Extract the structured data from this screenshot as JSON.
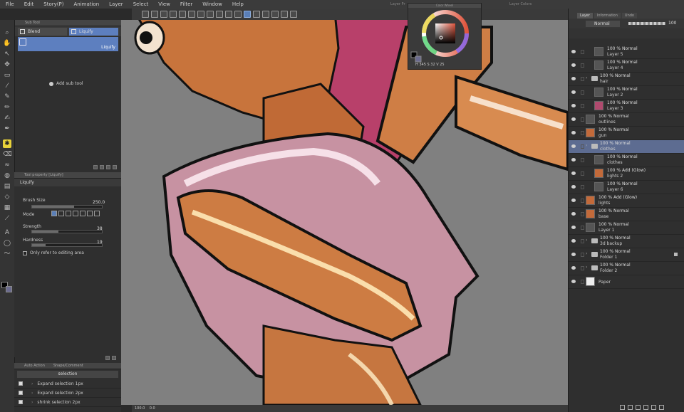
{
  "menu": {
    "items": [
      "File",
      "Edit",
      "Story(P)",
      "Animation",
      "Layer",
      "Select",
      "View",
      "Filter",
      "Window",
      "Help"
    ],
    "panel_titles": [
      "Layer Pr",
      "Color Wheel",
      "Layer Colors"
    ]
  },
  "sub_tool": {
    "header": "Sub Tool",
    "tabs": [
      "Blend",
      "Liquify"
    ],
    "selected_tool": "Liquify",
    "add_label": "Add sub tool"
  },
  "tool_property": {
    "header": "Tool property [Liquify]",
    "tool_name": "Liquify",
    "brush_size_label": "Brush Size",
    "brush_size_value": "250.0",
    "mode_label": "Mode",
    "strength_label": "Strength",
    "strength_value": "38",
    "hardness_label": "Hardness",
    "hardness_value": "19",
    "only_editing_label": "Only refer to editing area"
  },
  "auto_action": {
    "header": "Auto Action",
    "tab2": "Shape/Comment",
    "set_name": "selection",
    "items": [
      "Expand selection 1px",
      "Expand selection 2px",
      "shrink selection 2px"
    ]
  },
  "color_wheel": {
    "h": "345",
    "s": "32",
    "v": "25",
    "main_color": "#8b4f5b"
  },
  "layer_panel": {
    "tabs": [
      "Layer",
      "Information",
      "Undo"
    ],
    "blend_mode": "Normal",
    "opacity": "100",
    "layers": [
      {
        "l1": "100 % Normal",
        "l2": "Layer 5",
        "indent": 2,
        "thumb": "grey",
        "type": "layer"
      },
      {
        "l1": "100 % Normal",
        "l2": "Layer 4",
        "indent": 2,
        "thumb": "grey",
        "type": "layer"
      },
      {
        "l1": "100 % Normal",
        "l2": "hair",
        "indent": 1,
        "thumb": "white",
        "type": "folder"
      },
      {
        "l1": "100 % Normal",
        "l2": "Layer 2",
        "indent": 2,
        "thumb": "grey",
        "type": "layer"
      },
      {
        "l1": "100 % Normal",
        "l2": "Layer 3",
        "indent": 2,
        "thumb": "pink",
        "type": "layer"
      },
      {
        "l1": "100 % Normal",
        "l2": "outlines",
        "indent": 1,
        "thumb": "grey",
        "type": "layer"
      },
      {
        "l1": "100 % Normal",
        "l2": "gun",
        "indent": 1,
        "thumb": "orange",
        "type": "layer"
      },
      {
        "l1": "100 % Normal",
        "l2": "clothes",
        "indent": 1,
        "thumb": "white",
        "type": "folder",
        "selected": true
      },
      {
        "l1": "100 % Normal",
        "l2": "clothes",
        "indent": 2,
        "thumb": "grey",
        "type": "layer"
      },
      {
        "l1": "100 % Add (Glow)",
        "l2": "lights 2",
        "indent": 2,
        "thumb": "orange",
        "type": "layer"
      },
      {
        "l1": "100 % Normal",
        "l2": "Layer 6",
        "indent": 2,
        "thumb": "grey",
        "type": "layer"
      },
      {
        "l1": "100 % Add (Glow)",
        "l2": "lights",
        "indent": 1,
        "thumb": "orange",
        "type": "layer"
      },
      {
        "l1": "100 % Normal",
        "l2": "base",
        "indent": 1,
        "thumb": "orange",
        "type": "layer"
      },
      {
        "l1": "100 % Normal",
        "l2": "Layer 1",
        "indent": 1,
        "thumb": "grey",
        "type": "layer"
      },
      {
        "l1": "100 % Normal",
        "l2": "3d backup",
        "indent": 1,
        "thumb": "grey",
        "type": "folder"
      },
      {
        "l1": "100 % Normal",
        "l2": "Folder 1",
        "indent": 1,
        "thumb": "grey",
        "type": "folder",
        "locked": true
      },
      {
        "l1": "100 % Normal",
        "l2": "Folder 2",
        "indent": 1,
        "thumb": "grey",
        "type": "folder"
      },
      {
        "l1": "",
        "l2": "Paper",
        "indent": 1,
        "thumb": "white",
        "type": "paper"
      }
    ]
  },
  "status": {
    "zoom": "100.0",
    "rotation": "0.0"
  }
}
